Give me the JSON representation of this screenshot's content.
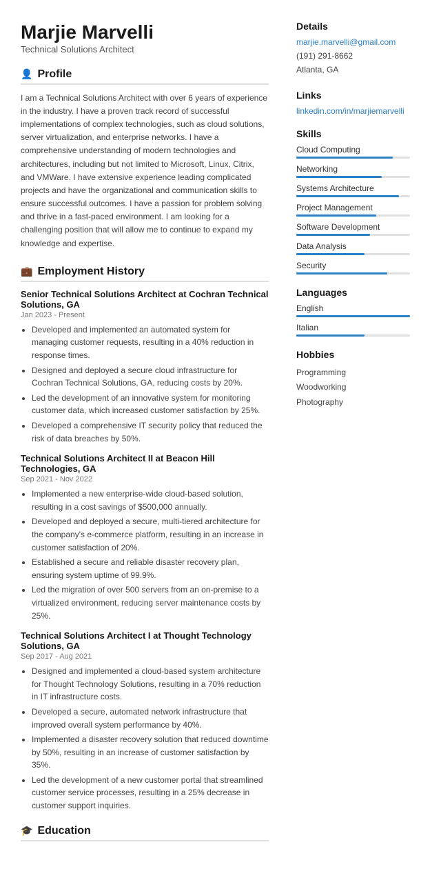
{
  "header": {
    "name": "Marjie Marvelli",
    "title": "Technical Solutions Architect"
  },
  "sections": {
    "profile": {
      "title": "Profile",
      "icon": "👤",
      "text": "I am a Technical Solutions Architect with over 6 years of experience in the industry. I have a proven track record of successful implementations of complex technologies, such as cloud solutions, server virtualization, and enterprise networks. I have a comprehensive understanding of modern technologies and architectures, including but not limited to Microsoft, Linux, Citrix, and VMWare. I have extensive experience leading complicated projects and have the organizational and communication skills to ensure successful outcomes. I have a passion for problem solving and thrive in a fast-paced environment. I am looking for a challenging position that will allow me to continue to expand my knowledge and expertise."
    },
    "employment": {
      "title": "Employment History",
      "icon": "💼",
      "jobs": [
        {
          "title": "Senior Technical Solutions Architect at Cochran Technical Solutions, GA",
          "date": "Jan 2023 - Present",
          "bullets": [
            "Developed and implemented an automated system for managing customer requests, resulting in a 40% reduction in response times.",
            "Designed and deployed a secure cloud infrastructure for Cochran Technical Solutions, GA, reducing costs by 20%.",
            "Led the development of an innovative system for monitoring customer data, which increased customer satisfaction by 25%.",
            "Developed a comprehensive IT security policy that reduced the risk of data breaches by 50%."
          ]
        },
        {
          "title": "Technical Solutions Architect II at Beacon Hill Technologies, GA",
          "date": "Sep 2021 - Nov 2022",
          "bullets": [
            "Implemented a new enterprise-wide cloud-based solution, resulting in a cost savings of $500,000 annually.",
            "Developed and deployed a secure, multi-tiered architecture for the company's e-commerce platform, resulting in an increase in customer satisfaction of 20%.",
            "Established a secure and reliable disaster recovery plan, ensuring system uptime of 99.9%.",
            "Led the migration of over 500 servers from an on-premise to a virtualized environment, reducing server maintenance costs by 25%."
          ]
        },
        {
          "title": "Technical Solutions Architect I at Thought Technology Solutions, GA",
          "date": "Sep 2017 - Aug 2021",
          "bullets": [
            "Designed and implemented a cloud-based system architecture for Thought Technology Solutions, resulting in a 70% reduction in IT infrastructure costs.",
            "Developed a secure, automated network infrastructure that improved overall system performance by 40%.",
            "Implemented a disaster recovery solution that reduced downtime by 50%, resulting in an increase of customer satisfaction by 35%.",
            "Led the development of a new customer portal that streamlined customer service processes, resulting in a 25% decrease in customer support inquiries."
          ]
        }
      ]
    },
    "education": {
      "title": "Education",
      "icon": "🎓"
    }
  },
  "right": {
    "details": {
      "title": "Details",
      "email": "marjie.marvelli@gmail.com",
      "phone": "(191) 291-8662",
      "location": "Atlanta, GA"
    },
    "links": {
      "title": "Links",
      "linkedin": "linkedin.com/in/marjiemarvelli"
    },
    "skills": {
      "title": "Skills",
      "items": [
        {
          "label": "Cloud Computing",
          "pct": 85
        },
        {
          "label": "Networking",
          "pct": 75
        },
        {
          "label": "Systems Architecture",
          "pct": 90
        },
        {
          "label": "Project Management",
          "pct": 70
        },
        {
          "label": "Software Development",
          "pct": 65
        },
        {
          "label": "Data Analysis",
          "pct": 60
        },
        {
          "label": "Security",
          "pct": 80
        }
      ]
    },
    "languages": {
      "title": "Languages",
      "items": [
        {
          "label": "English",
          "pct": 100
        },
        {
          "label": "Italian",
          "pct": 60
        }
      ]
    },
    "hobbies": {
      "title": "Hobbies",
      "items": [
        "Programming",
        "Woodworking",
        "Photography"
      ]
    }
  }
}
